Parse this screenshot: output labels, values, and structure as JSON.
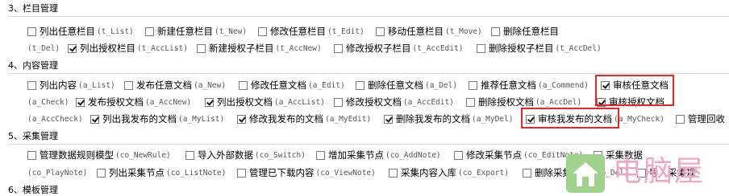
{
  "sections": [
    {
      "heading": "3、栏目管理",
      "lines": [
        [
          {
            "name": "列出任意栏目",
            "code": "(t_List)",
            "checked": false
          },
          {
            "name": "新建任意栏目",
            "code": "(t_New)",
            "checked": false
          },
          {
            "name": "修改任意栏目",
            "code": "(t_Edit)",
            "checked": false
          },
          {
            "name": "移动任意栏目",
            "code": "(t_Move)",
            "checked": false
          },
          {
            "name": "删除任意栏目",
            "code": "",
            "checked": false
          }
        ],
        [
          {
            "name": "",
            "code": "(t_Del)",
            "checked": null
          },
          {
            "name": "列出授权栏目",
            "code": "(t_AccList)",
            "checked": true
          },
          {
            "name": "新建授权子栏目",
            "code": "(t_AccNew)",
            "checked": false
          },
          {
            "name": "修改授权子栏目",
            "code": "(t_AccEdit)",
            "checked": false
          },
          {
            "name": "删除授权子栏目",
            "code": "(t_AccDel)",
            "checked": false
          }
        ]
      ]
    },
    {
      "heading": "4、内容管理",
      "lines": [
        [
          {
            "name": "列出内容",
            "code": "(a_List)",
            "checked": false
          },
          {
            "name": "发布任意文档",
            "code": "(a_New)",
            "checked": false
          },
          {
            "name": "修改任意文档",
            "code": "(a_Edit)",
            "checked": false
          },
          {
            "name": "删除任意文档",
            "code": "(a_Del)",
            "checked": false
          },
          {
            "name": "推荐任意文档",
            "code": "(a_Commend)",
            "checked": false
          },
          {
            "name": "审核任意文档",
            "code": "",
            "checked": true
          }
        ],
        [
          {
            "name": "",
            "code": "(a_Check)",
            "checked": null
          },
          {
            "name": "发布授权文档",
            "code": "(a_AccNew)",
            "checked": true
          },
          {
            "name": "列出授权文档",
            "code": "(a_AccList)",
            "checked": true
          },
          {
            "name": "修改授权文档",
            "code": "(a_AccEdit)",
            "checked": false
          },
          {
            "name": "删除授权文档",
            "code": "(a_AccDel)",
            "checked": false
          },
          {
            "name": "审核授权文档",
            "code": "",
            "checked": true
          }
        ],
        [
          {
            "name": "",
            "code": "(a_AccCheck)",
            "checked": null
          },
          {
            "name": "列出我发布的文档",
            "code": "(a_MyList)",
            "checked": true
          },
          {
            "name": "修改我发布的文档",
            "code": "(a_MyEdit)",
            "checked": true
          },
          {
            "name": "删除我发布的文档",
            "code": "(a_MyDel)",
            "checked": true
          },
          {
            "name": "审核我发布的文档",
            "code": "(a_MyCheck)",
            "checked": true
          },
          {
            "name": "管理回收",
            "code": "",
            "checked": false
          }
        ]
      ]
    },
    {
      "heading": "5、采集管理",
      "lines": [
        [
          {
            "name": "管理数据规则模型",
            "code": "(co_NewRule)",
            "checked": false
          },
          {
            "name": "导入外部数据",
            "code": "(co_Switch)",
            "checked": false
          },
          {
            "name": "增加采集节点",
            "code": "(co_AddNote)",
            "checked": false
          },
          {
            "name": "修改采集节点",
            "code": "(co_EditNote)",
            "checked": false
          },
          {
            "name": "采集数据",
            "code": "",
            "checked": false
          }
        ],
        [
          {
            "name": "",
            "code": "(co_PlayNote)",
            "checked": null
          },
          {
            "name": "列出采集节点",
            "code": "(co_ListNote)",
            "checked": false
          },
          {
            "name": "管理已下载内容",
            "code": "(co_ViewNote)",
            "checked": false
          },
          {
            "name": "采集内容入库",
            "code": "(co_Export)",
            "checked": false
          },
          {
            "name": "删除采集节点",
            "code": "(co_Del)",
            "checked": false
          },
          {
            "name": "导入采集规",
            "code": "",
            "checked": false
          }
        ]
      ]
    },
    {
      "heading": "6、模板管理",
      "lines": []
    }
  ],
  "watermark": {
    "text": "电脑屋"
  },
  "colors": {
    "highlight": "#e8262a",
    "separator": "#d8d8d8",
    "code_text": "#555555"
  }
}
